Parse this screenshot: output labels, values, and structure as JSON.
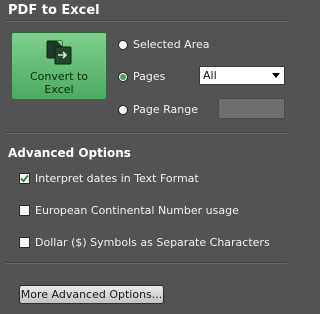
{
  "panel": {
    "title": "PDF to Excel"
  },
  "convert_button": {
    "label": "Convert to Excel",
    "icon": "convert-to-excel-icon",
    "color_top": "#7fd08e",
    "color_bottom": "#4caa60"
  },
  "page_selection": {
    "options": [
      {
        "label": "Selected Area",
        "selected": false
      },
      {
        "label": "Pages",
        "selected": true
      },
      {
        "label": "Page Range",
        "selected": false
      }
    ],
    "pages_select_value": "All",
    "page_range_value": ""
  },
  "advanced_options": {
    "title": "Advanced Options",
    "checkboxes": [
      {
        "label": "Interpret dates in Text Format",
        "checked": true
      },
      {
        "label": "European Continental Number usage",
        "checked": false
      },
      {
        "label": "Dollar ($) Symbols as Separate Characters",
        "checked": false
      }
    ],
    "more_button_label": "More Advanced Options..."
  }
}
